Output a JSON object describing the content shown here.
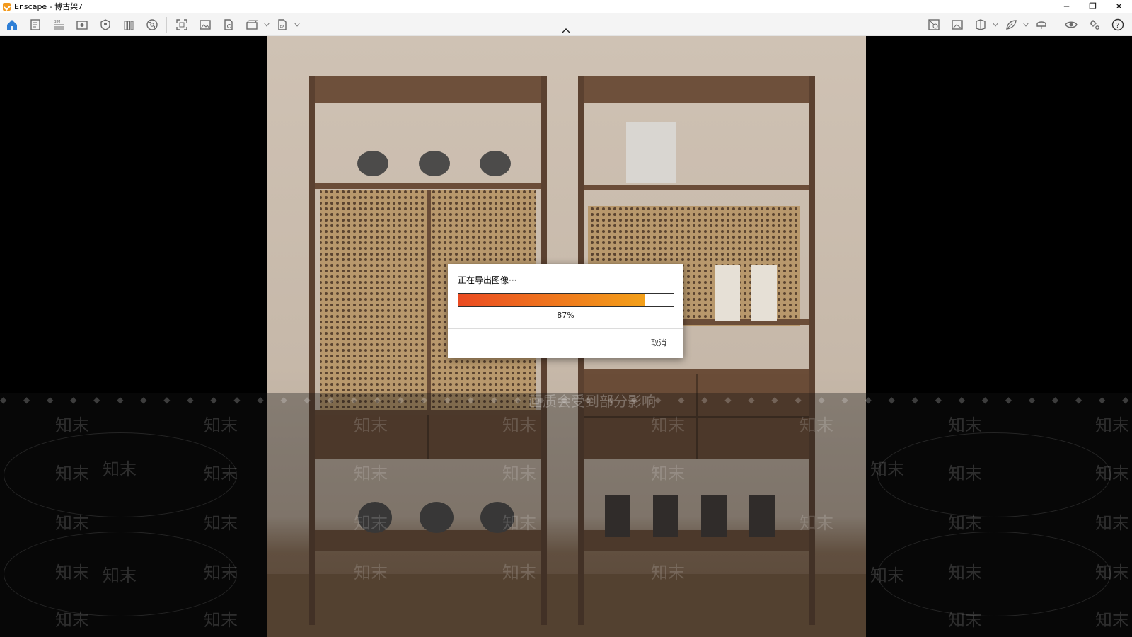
{
  "window": {
    "title": "Enscape - 博古架7",
    "controls": {
      "minimize_glyph": "─",
      "restore_glyph": "❐",
      "close_glyph": "✕"
    }
  },
  "toolbar": {
    "left_icons": [
      "home-icon",
      "project-icon",
      "bim-icon",
      "views-icon",
      "assets-icon",
      "library-icon",
      "material-icon",
      "screenshot-icon",
      "batch-render-icon",
      "export-icon",
      "video-icon",
      "standalone-export-icon"
    ],
    "right_icons": [
      "site-context-icon",
      "atmosphere-icon",
      "section-icon",
      "feedback-icon",
      "vr-icon",
      "visual-settings-icon",
      "settings-icon",
      "help-icon"
    ],
    "accent_color": "#2f7fd6"
  },
  "watermark": {
    "diamonds": "◆ ◆ ◆ ◆ ◆ ◆ ◆ ◆ ◆ ◆ ◆ ◆ ◆ ◆ ◆ ◆ ◆ ◆ ◆ ◆ ◆ ◆ ◆ ◆ ◆ ◆ ◆ ◆ ◆ ◆ ◆ ◆ ◆ ◆ ◆ ◆ ◆ ◆ ◆ ◆ ◆ ◆ ◆ ◆ ◆ ◆ ◆ ◆ ◆ ◆ ◆ ◆ ◆ ◆ ◆ ◆ ◆",
    "notice": "画质会受到部分影响",
    "mark": "知末"
  },
  "export_dialog": {
    "title": "正在导出图像···",
    "progress": 0.87,
    "progress_label": "87%",
    "cancel_label": "取消",
    "progress_colors": [
      "#ea4b22",
      "#f3a019"
    ]
  }
}
